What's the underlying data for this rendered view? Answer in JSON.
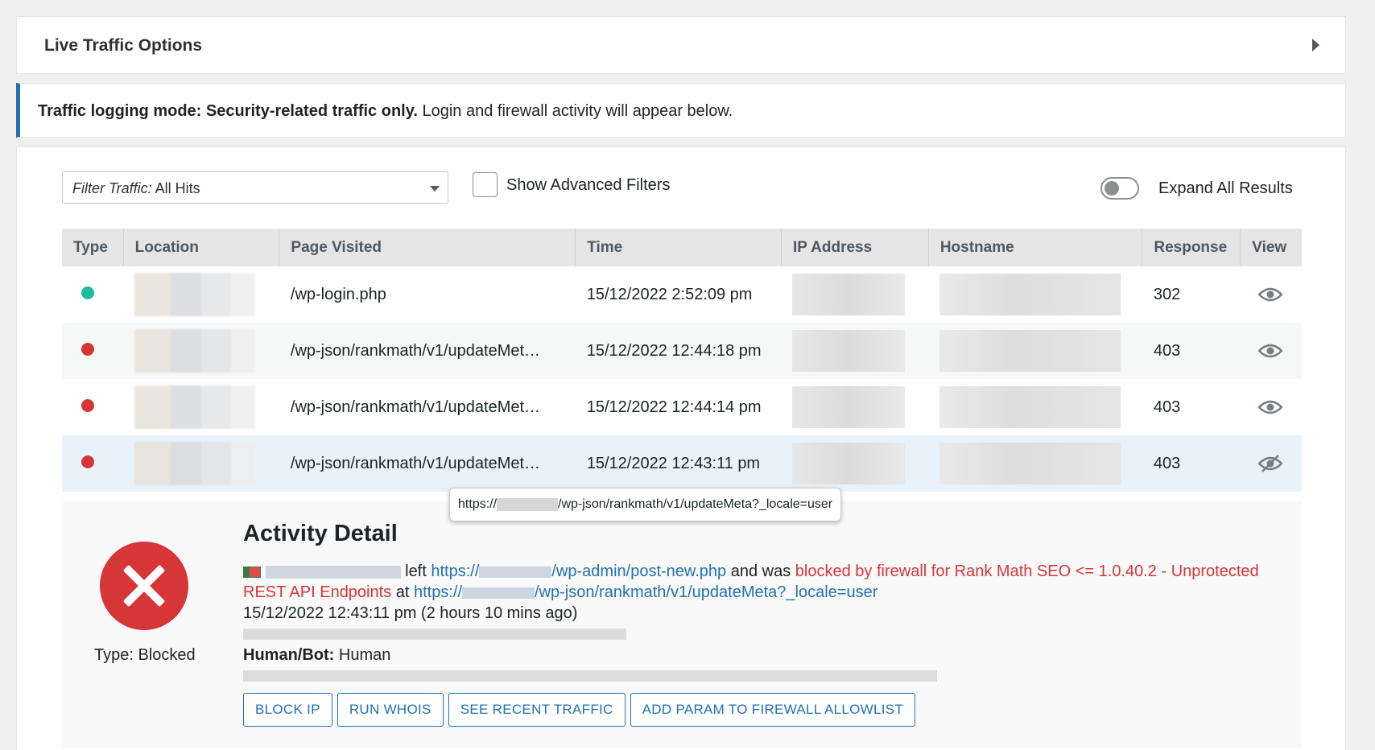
{
  "options": {
    "title": "Live Traffic Options"
  },
  "notice": {
    "bold": "Traffic logging mode: Security-related traffic only.",
    "text": " Login and firewall activity will appear below."
  },
  "filters": {
    "select_prefix": "Filter Traffic:",
    "select_value": " All Hits",
    "advanced_label": "Show Advanced Filters",
    "expand_label": "Expand All Results"
  },
  "table": {
    "headers": [
      "Type",
      "Location",
      "Page Visited",
      "Time",
      "IP Address",
      "Hostname",
      "Response",
      "View"
    ],
    "rows": [
      {
        "status_color": "#1ebc9c",
        "page": "/wp-login.php",
        "time": "15/12/2022 2:52:09 pm",
        "response": "302",
        "view_icon": "eye-icon"
      },
      {
        "status_color": "#d63638",
        "page": "/wp-json/rankmath/v1/updateMet…",
        "time": "15/12/2022 12:44:18 pm",
        "response": "403",
        "view_icon": "eye-icon"
      },
      {
        "status_color": "#d63638",
        "page": "/wp-json/rankmath/v1/updateMet…",
        "time": "15/12/2022 12:44:14 pm",
        "response": "403",
        "view_icon": "eye-icon"
      },
      {
        "status_color": "#d63638",
        "page": "/wp-json/rankmath/v1/updateMet…",
        "time": "15/12/2022 12:43:11 pm",
        "response": "403",
        "view_icon": "eye-slash-icon"
      }
    ]
  },
  "tooltip": {
    "prefix": "https://",
    "suffix": "/wp-json/rankmath/v1/updateMeta?_locale=user"
  },
  "detail": {
    "title": "Activity Detail",
    "type_label": "Type: Blocked",
    "left_word": " left ",
    "left_url_prefix": "https://",
    "left_url_suffix": "/wp-admin/post-new.php",
    "and_was": " and was ",
    "blocked_text": "blocked by firewall for Rank Math SEO <= 1.0.40.2 - Unprotected REST API Endpoints",
    "at_word": " at ",
    "at_url_prefix": "https://",
    "at_url_suffix": "/wp-json/rankmath/v1/updateMeta?_locale=user",
    "timestamp": "15/12/2022 12:43:11 pm (2 hours 10 mins ago)",
    "human_bot_label": "Human/Bot:",
    "human_bot_value": " Human",
    "buttons": [
      "BLOCK IP",
      "RUN WHOIS",
      "SEE RECENT TRAFFIC",
      "ADD PARAM TO FIREWALL ALLOWLIST"
    ]
  }
}
